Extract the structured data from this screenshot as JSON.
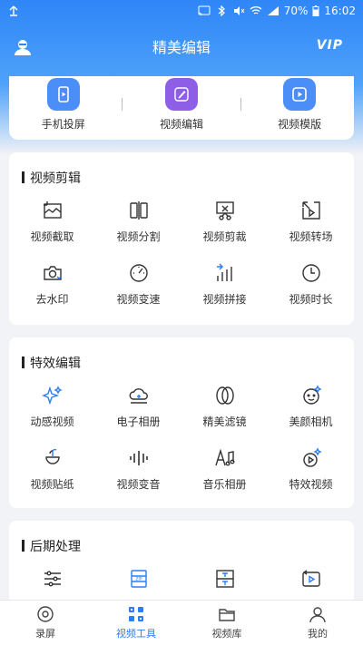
{
  "status_bar": {
    "battery": "70%",
    "time": "16:02"
  },
  "header": {
    "title": "精美编辑",
    "vip": "VIP"
  },
  "quick_actions": [
    {
      "label": "手机投屏",
      "icon": "screen-cast-icon",
      "color": "#4b8ef8"
    },
    {
      "label": "视频编辑",
      "icon": "pencil-icon",
      "color": "#8e5fe6"
    },
    {
      "label": "视频模版",
      "icon": "video-template-icon",
      "color": "#4b8ef8"
    }
  ],
  "sections": {
    "video_edit": {
      "title": "视频剪辑",
      "tools": [
        {
          "label": "视频截取",
          "icon": "crop-icon"
        },
        {
          "label": "视频分割",
          "icon": "split-icon"
        },
        {
          "label": "视频剪裁",
          "icon": "cut-icon"
        },
        {
          "label": "视频转场",
          "icon": "transition-icon"
        },
        {
          "label": "去水印",
          "icon": "remove-watermark-icon"
        },
        {
          "label": "视频变速",
          "icon": "speed-icon"
        },
        {
          "label": "视频拼接",
          "icon": "merge-icon"
        },
        {
          "label": "视频时长",
          "icon": "clock-icon"
        }
      ]
    },
    "effects": {
      "title": "特效编辑",
      "tools": [
        {
          "label": "动感视频",
          "icon": "sparkle-icon"
        },
        {
          "label": "电子相册",
          "icon": "cloud-album-icon"
        },
        {
          "label": "精美滤镜",
          "icon": "filter-icon"
        },
        {
          "label": "美颜相机",
          "icon": "beauty-face-icon"
        },
        {
          "label": "视频贴纸",
          "icon": "sticker-icon"
        },
        {
          "label": "视频变音",
          "icon": "voice-change-icon"
        },
        {
          "label": "音乐相册",
          "icon": "music-album-icon"
        },
        {
          "label": "特效视频",
          "icon": "effects-video-icon"
        }
      ]
    },
    "post": {
      "title": "后期处理",
      "tools": [
        {
          "label": "",
          "icon": "adjust-sliders-icon"
        },
        {
          "label": "",
          "icon": "zip-compress-icon"
        },
        {
          "label": "",
          "icon": "text-icon"
        },
        {
          "label": "",
          "icon": "reverse-play-icon"
        }
      ]
    }
  },
  "bottom_nav": [
    {
      "label": "录屏",
      "icon": "record-icon",
      "active": false
    },
    {
      "label": "视频工具",
      "icon": "tools-icon",
      "active": true
    },
    {
      "label": "视频库",
      "icon": "folder-icon",
      "active": false
    },
    {
      "label": "我的",
      "icon": "profile-icon",
      "active": false
    }
  ],
  "colors": {
    "accent": "#2a7ef6",
    "icon_line": "#333333"
  }
}
